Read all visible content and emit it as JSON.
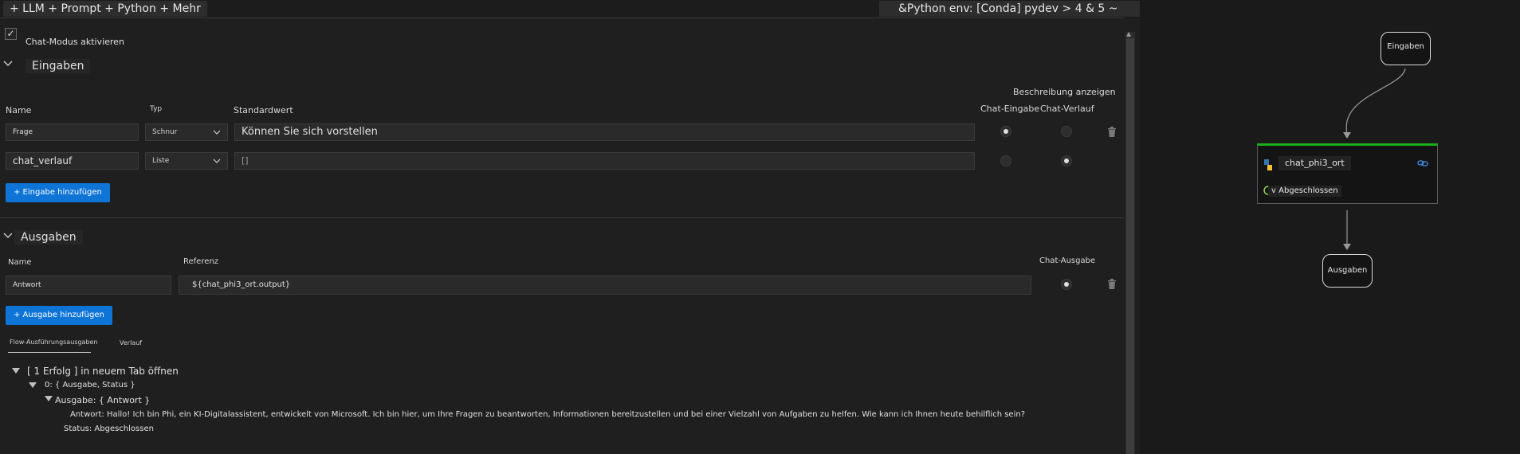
{
  "toolbar": {
    "title": "+ LLM + Prompt + Python + Mehr",
    "env": "&Python env: [Conda] pydev > 4 & 5 ~"
  },
  "chat_mode": {
    "label": "Chat-Modus aktivieren",
    "checked": true
  },
  "inputs_section": {
    "title": "Eingaben",
    "show_description": "Beschreibung anzeigen",
    "columns": {
      "name": "Name",
      "type": "Typ",
      "default": "Standardwert",
      "chat_input": "Chat-Eingabe",
      "chat_history": "Chat-Verlauf"
    },
    "rows": [
      {
        "name": "Frage",
        "type": "Schnur",
        "default": "Können Sie sich vorstellen",
        "chat_input": true,
        "chat_history": false
      },
      {
        "name": "chat_verlauf",
        "type": "Liste",
        "default": "[]",
        "chat_input": false,
        "chat_history": true
      }
    ],
    "add_button": "+ Eingabe hinzufügen"
  },
  "outputs_section": {
    "title": "Ausgaben",
    "columns": {
      "name": "Name",
      "reference": "Referenz",
      "chat_output": "Chat-Ausgabe"
    },
    "rows": [
      {
        "name": "Antwort",
        "reference": "${chat_phi3_ort.output}",
        "chat_output": true
      }
    ],
    "add_button": "+ Ausgabe hinzufügen"
  },
  "tabs": [
    {
      "label": "Flow-Ausführungsausgaben",
      "active": true
    },
    {
      "label": "Verlauf",
      "active": false
    }
  ],
  "tree": {
    "root": "[ 1 Erfolg ] in neuem Tab öffnen",
    "level1": "0: { Ausgabe, Status }",
    "level2": "Ausgabe: { Antwort }",
    "answer": "Antwort: Hallo! Ich bin Phi, ein KI-Digitalassistent, entwickelt von Microsoft. Ich bin hier, um Ihre Fragen zu beantworten, Informationen bereitzustellen und bei einer Vielzahl von Aufgaben zu helfen. Wie kann ich Ihnen heute behilflich sein?",
    "status": "Status: Abgeschlossen"
  },
  "graph": {
    "input_node": "Eingaben",
    "main_node": {
      "title": "chat_phi3_ort",
      "status": "v Abgeschlossen"
    },
    "output_node": "Ausgaben"
  },
  "colors": {
    "accent": "#0e74d6",
    "success": "#18b018",
    "background": "#1e1e1e"
  },
  "icons": [
    "checkmark-icon",
    "chevron-down-icon",
    "trash-icon",
    "python-icon",
    "link-icon",
    "spinner-icon"
  ]
}
